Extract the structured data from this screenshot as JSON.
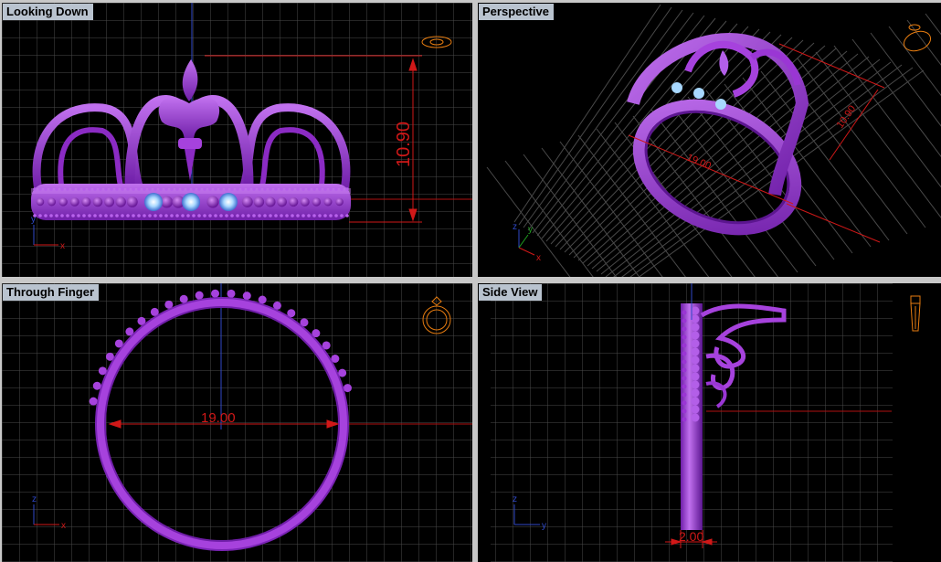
{
  "colors": {
    "background": "#000000",
    "grid": "#4a4a4a",
    "model": "#9d2fd6",
    "dimension": "#d01818",
    "gem": "#a8d8ff",
    "label_bg": "#b9c3cf",
    "widget": "#e87d10"
  },
  "viewports": {
    "top_left": {
      "label": "Looking Down",
      "dimension": "10.90",
      "axis_x": "x",
      "axis_y": "y",
      "widget_icon": "ring-top-view-icon"
    },
    "top_right": {
      "label": "Perspective",
      "dimension_width": "19.00",
      "dimension_height": "10.90",
      "axis_x": "x",
      "axis_y": "y",
      "axis_z": "z",
      "widget_icon": "ring-perspective-icon"
    },
    "bottom_left": {
      "label": "Through Finger",
      "dimension": "19.00",
      "axis_x": "x",
      "axis_z": "z",
      "widget_icon": "ring-front-icon"
    },
    "bottom_right": {
      "label": "Side View",
      "dimension": "2.00",
      "axis_y": "y",
      "axis_z": "z",
      "widget_icon": "ring-side-icon"
    }
  }
}
